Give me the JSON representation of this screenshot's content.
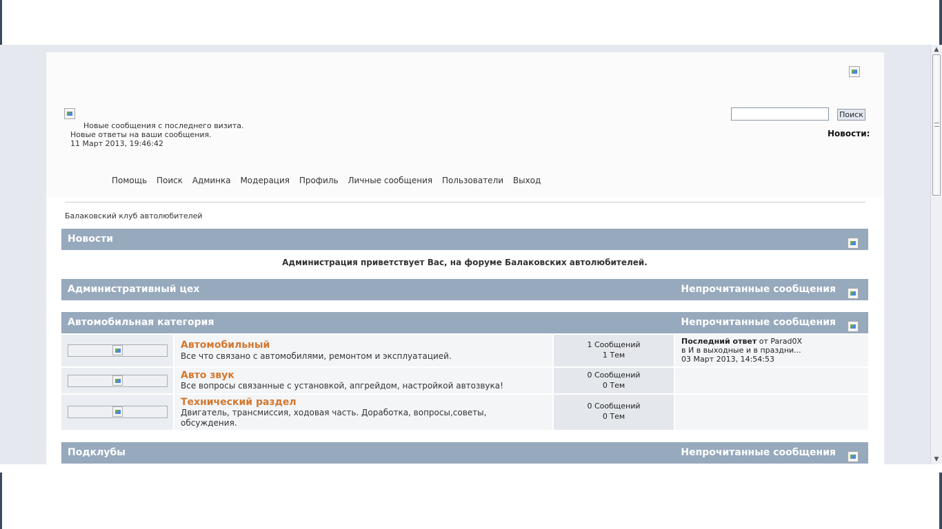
{
  "header": {
    "new_posts_text": "Новые сообщения с последнего визита.",
    "new_replies_text": "Новые ответы на ваши сообщения.",
    "datetime": "11 Март 2013, 19:46:42",
    "search_button": "Поиск",
    "search_value": "",
    "news_label": "Новости:"
  },
  "nav": {
    "items": [
      "Помощь",
      "Поиск",
      "Админка",
      "Модерация",
      "Профиль",
      "Личные сообщения",
      "Пользователи",
      "Выход"
    ]
  },
  "breadcrumb": "Балаковский клуб автолюбителей",
  "news_section": {
    "title": "Новости",
    "message": "Администрация приветствует Вас, на форуме Балаковских автолюбителей."
  },
  "categories": [
    {
      "title": "Административный цех",
      "unread": "Непрочитанные сообщения"
    },
    {
      "title": "Автомобильная категория",
      "unread": "Непрочитанные сообщения"
    },
    {
      "title": "Подклубы",
      "unread": "Непрочитанные сообщения"
    }
  ],
  "boards": [
    {
      "name": "Автомобильный",
      "desc": "Все что связано с автомобилями, ремонтом и эксплуатацией.",
      "posts": "1 Сообщений",
      "topics": "1 Тем",
      "last_post_label": "Последний ответ",
      "last_post_by": " от Parad0X",
      "last_post_topic": "в И в выходные и в праздни...",
      "last_post_date": "03 Март 2013, 14:54:53"
    },
    {
      "name": "Авто звук",
      "desc": "Все вопросы связанные с установкой, апгрейдом, настройкой автозвука!",
      "posts": "0 Сообщений",
      "topics": "0 Тем"
    },
    {
      "name": "Технический раздел",
      "desc": "Двигатель, трансмиссия, ходовая часть. Доработка, вопросы,советы, обсуждения.",
      "posts": "0 Сообщений",
      "topics": "0 Тем"
    }
  ]
}
